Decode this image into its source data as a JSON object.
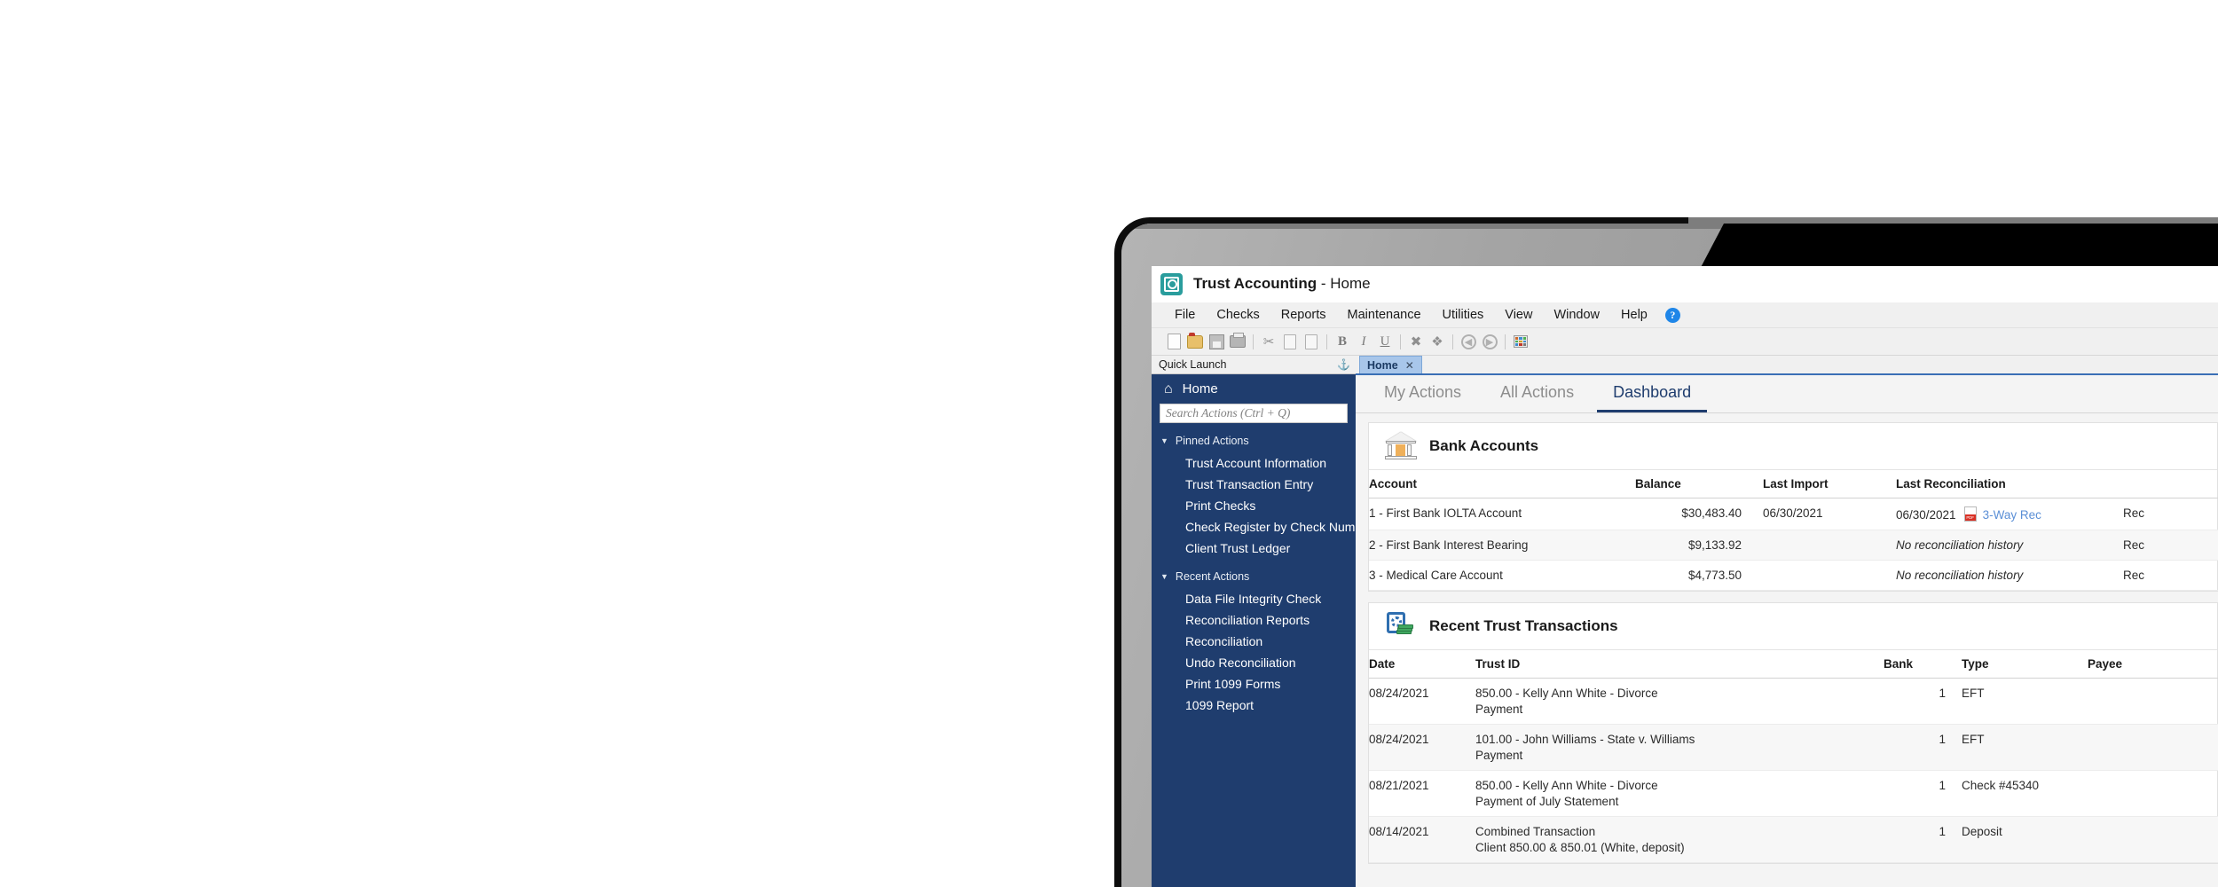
{
  "window": {
    "title_main": "Trust Accounting",
    "title_sep": " - ",
    "title_sub": "Home",
    "app_icon": "vault-icon"
  },
  "menubar": {
    "items": [
      "File",
      "Checks",
      "Reports",
      "Maintenance",
      "Utilities",
      "View",
      "Window",
      "Help"
    ],
    "help_icon": "help-circle-icon",
    "help_glyph": "?"
  },
  "toolbar": {
    "buttons": [
      {
        "name": "new-file-icon"
      },
      {
        "name": "open-folder-icon"
      },
      {
        "name": "save-icon"
      },
      {
        "name": "print-icon"
      },
      {
        "name": "cut-icon",
        "glyph": "✂"
      },
      {
        "name": "copy-icon"
      },
      {
        "name": "paste-icon"
      },
      {
        "name": "bold-icon",
        "glyph": "B"
      },
      {
        "name": "italic-icon",
        "glyph": "I"
      },
      {
        "name": "underline-icon",
        "glyph": "U"
      },
      {
        "name": "delete-icon",
        "glyph": "✖"
      },
      {
        "name": "undelete-icon",
        "glyph": "❖"
      },
      {
        "name": "back-arrow-icon",
        "glyph": "◀"
      },
      {
        "name": "forward-arrow-icon",
        "glyph": "▶"
      },
      {
        "name": "grid-view-icon"
      }
    ]
  },
  "sidebar": {
    "panel_title": "Quick Launch",
    "pin_icon": "pin-icon",
    "pin_glyph": "⚓",
    "home_label": "Home",
    "home_icon": "home-icon",
    "home_glyph": "⌂",
    "search_placeholder": "Search Actions (Ctrl + Q)",
    "groups": [
      {
        "label": "Pinned Actions",
        "items": [
          "Trust Account Information",
          "Trust Transaction Entry",
          "Print Checks",
          "Check Register by Check Number",
          "Client Trust Ledger"
        ]
      },
      {
        "label": "Recent Actions",
        "items": [
          "Data File Integrity Check",
          "Reconciliation Reports",
          "Reconciliation",
          "Undo Reconciliation",
          "Print 1099 Forms",
          "1099 Report"
        ]
      }
    ]
  },
  "document_tab": {
    "label": "Home",
    "close_glyph": "✕"
  },
  "subtabs": [
    {
      "label": "My Actions",
      "active": false
    },
    {
      "label": "All Actions",
      "active": false
    },
    {
      "label": "Dashboard",
      "active": true
    }
  ],
  "bank_accounts": {
    "title": "Bank Accounts",
    "icon": "bank-building-icon",
    "columns": [
      "Account",
      "Balance",
      "Last Import",
      "Last Reconciliation",
      ""
    ],
    "rows": [
      {
        "account": "1 - First Bank IOLTA Account",
        "balance": "$30,483.40",
        "last_import": "06/30/2021",
        "last_reconciliation": "06/30/2021",
        "has_pdf": true,
        "pdf_icon": "pdf-icon",
        "three_way_link": "3-Way Rec",
        "rec_link": "Rec",
        "no_history": false
      },
      {
        "account": "2 - First Bank Interest Bearing",
        "balance": "$9,133.92",
        "last_import": "",
        "last_reconciliation": "No reconciliation history",
        "has_pdf": false,
        "three_way_link": "",
        "rec_link": "Rec",
        "no_history": true
      },
      {
        "account": "3 - Medical Care Account",
        "balance": "$4,773.50",
        "last_import": "",
        "last_reconciliation": "No reconciliation history",
        "has_pdf": false,
        "three_way_link": "",
        "rec_link": "Rec",
        "no_history": true
      }
    ]
  },
  "recent_transactions": {
    "title": "Recent Trust Transactions",
    "icon": "safe-with-money-icon",
    "columns": [
      "Date",
      "Trust ID",
      "Bank",
      "Type",
      "Payee"
    ],
    "rows": [
      {
        "date": "08/24/2021",
        "trust_id": "850.00 - Kelly Ann White - Divorce",
        "trust_id_note": "Payment",
        "bank": "1",
        "type": "EFT",
        "payee": ""
      },
      {
        "date": "08/24/2021",
        "trust_id": "101.00 - John Williams - State v. Williams",
        "trust_id_note": "Payment",
        "bank": "1",
        "type": "EFT",
        "payee": ""
      },
      {
        "date": "08/21/2021",
        "trust_id": "850.00 - Kelly Ann White - Divorce",
        "trust_id_note": "Payment of July Statement",
        "bank": "1",
        "type": "Check #45340",
        "payee": ""
      },
      {
        "date": "08/14/2021",
        "trust_id": "Combined Transaction",
        "trust_id_note": "Client 850.00 & 850.01 (White, deposit)",
        "bank": "1",
        "type": "Deposit",
        "payee": ""
      }
    ]
  },
  "colors": {
    "sidebar_navy": "#1f3d6e",
    "accent_blue": "#3a6fb5",
    "link_blue": "#5b8fd6",
    "app_teal": "#2a9d9d",
    "pdf_red": "#d93025"
  }
}
